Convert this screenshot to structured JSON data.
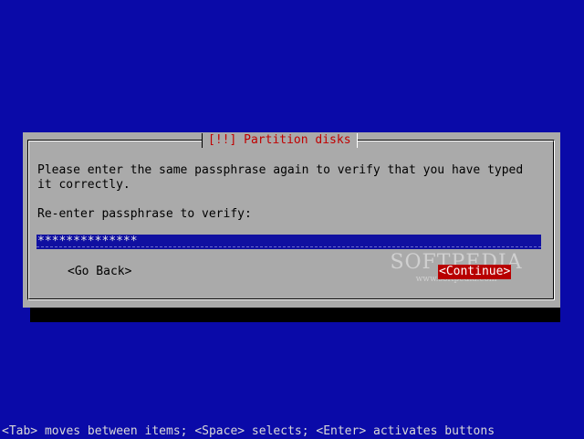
{
  "dialog": {
    "title": "[!!] Partition disks",
    "message_line1": "Please enter the same passphrase again to verify that you have typed",
    "message_line2": "it correctly.",
    "prompt": "Re-enter passphrase to verify:",
    "passphrase_value": "**************",
    "buttons": {
      "back": "<Go Back>",
      "continue": "<Continue>"
    }
  },
  "watermark": {
    "brand": "SOFTPEDIA",
    "url": "www.softpedia.com"
  },
  "help_line": "<Tab> moves between items; <Space> selects; <Enter> activates buttons",
  "colors": {
    "background": "#0a0aa8",
    "dialog": "#aaaaaa",
    "title_text": "#c00000",
    "selected_button": "#b80000",
    "input_field": "#1010a0"
  }
}
